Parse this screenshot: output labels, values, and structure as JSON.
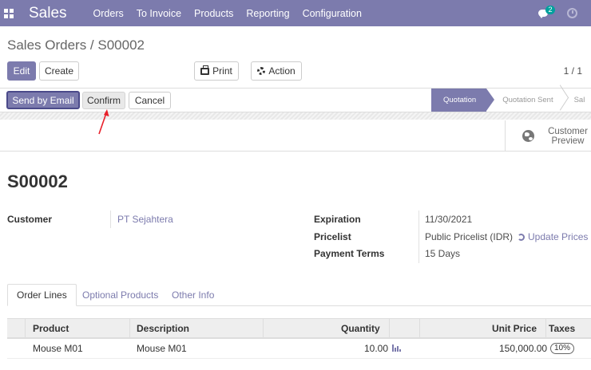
{
  "topbar": {
    "app_name": "Sales",
    "menu": [
      "Orders",
      "To Invoice",
      "Products",
      "Reporting",
      "Configuration"
    ],
    "chat_count": "2"
  },
  "breadcrumb": "Sales Orders / S00002",
  "toolbar": {
    "edit": "Edit",
    "create": "Create",
    "print": "Print",
    "action": "Action",
    "pager": "1 / 1"
  },
  "statusbar": {
    "send_email": "Send by Email",
    "confirm": "Confirm",
    "cancel": "Cancel",
    "stages": [
      "Quotation",
      "Quotation Sent",
      "Sal"
    ],
    "active_stage": "Quotation"
  },
  "preview": {
    "label": "Customer Preview"
  },
  "order": {
    "name": "S00002",
    "customer_label": "Customer",
    "customer": "PT Sejahtera",
    "expiration_label": "Expiration",
    "expiration": "11/30/2021",
    "pricelist_label": "Pricelist",
    "pricelist": "Public Pricelist (IDR)",
    "update_prices": "Update Prices",
    "payment_terms_label": "Payment Terms",
    "payment_terms": "15 Days"
  },
  "tabs": [
    "Order Lines",
    "Optional Products",
    "Other Info"
  ],
  "table": {
    "columns": [
      "Product",
      "Description",
      "Quantity",
      "Unit Price",
      "Taxes"
    ],
    "rows": [
      {
        "product": "Mouse M01",
        "description": "Mouse M01",
        "quantity": "10.00",
        "unit_price": "150,000.00",
        "taxes": "10%"
      }
    ]
  },
  "colors": {
    "brand": "#7c7bad",
    "accent_badge": "#00a09d",
    "annotation_arrow": "#e8202a"
  }
}
